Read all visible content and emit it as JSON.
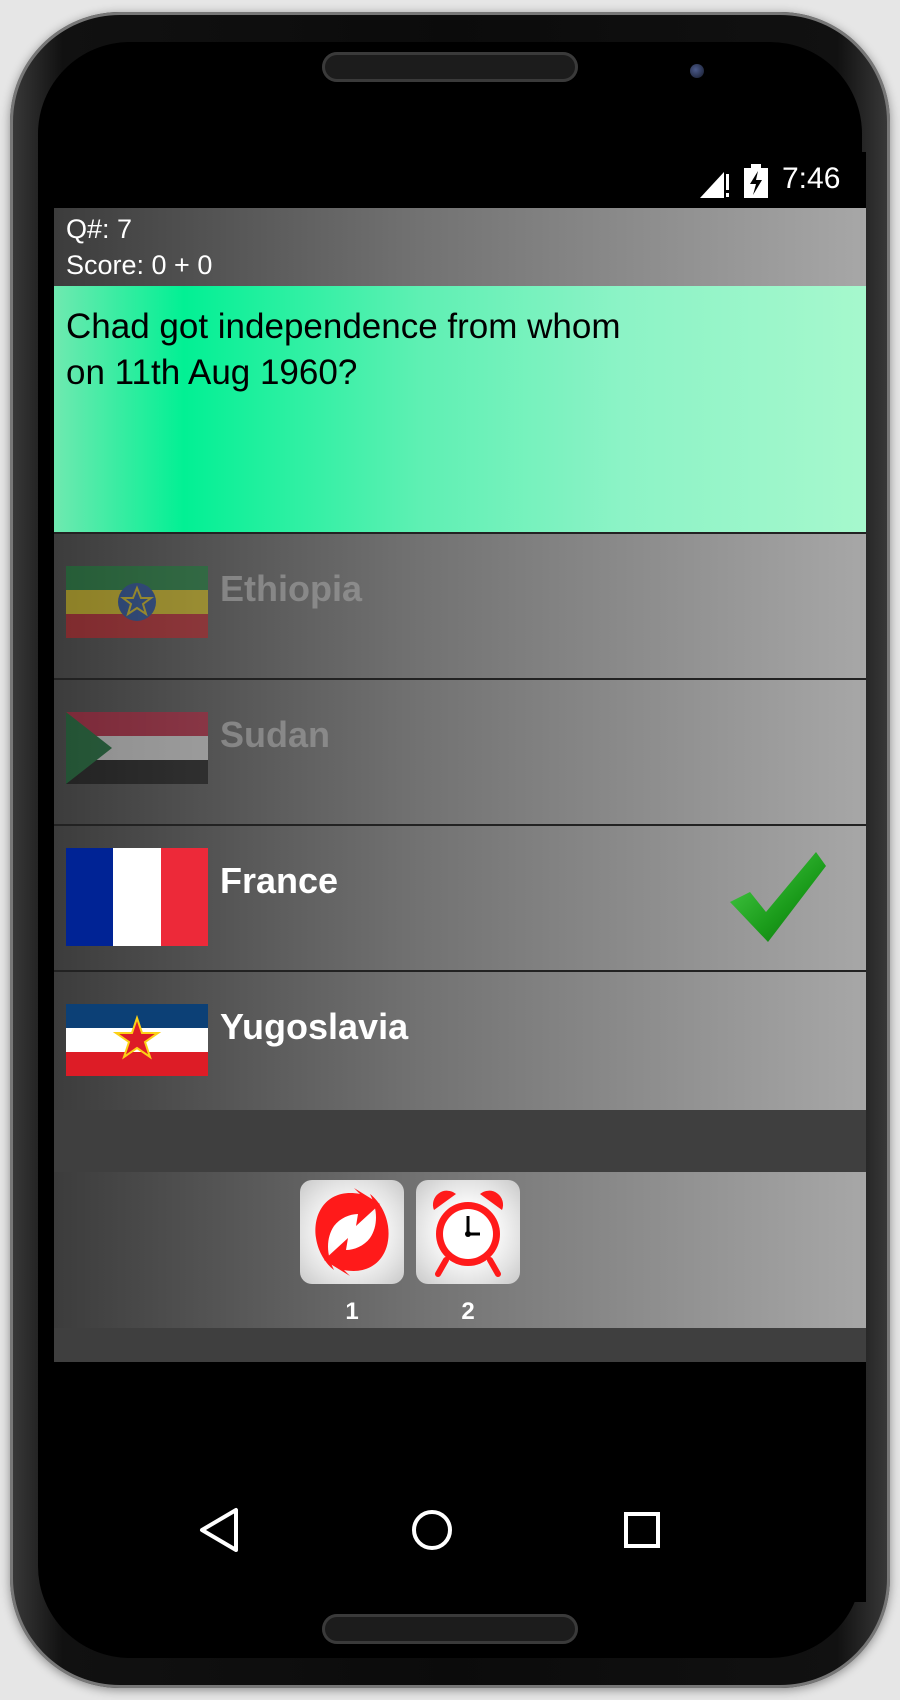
{
  "status_bar": {
    "time": "7:46",
    "icons": [
      "signal-icon",
      "battery-charging-icon"
    ]
  },
  "quiz": {
    "question_number_label": "Q#: 7",
    "score_label": "Score: 0 + 0",
    "question": "Chad got independence from whom on 11th Aug 1960?"
  },
  "answers": [
    {
      "label": "Ethiopia",
      "flag_icon": "ethiopia-flag-icon",
      "state": "eliminated"
    },
    {
      "label": "Sudan",
      "flag_icon": "sudan-flag-icon",
      "state": "eliminated"
    },
    {
      "label": "France",
      "flag_icon": "france-flag-icon",
      "state": "correct"
    },
    {
      "label": "Yugoslavia",
      "flag_icon": "yugoslavia-flag-icon",
      "state": "normal"
    }
  ],
  "lifelines": [
    {
      "icon": "refresh-arrows-icon",
      "count": "1"
    },
    {
      "icon": "alarm-clock-icon",
      "count": "2"
    }
  ],
  "navigation": [
    "back-icon",
    "home-icon",
    "recents-icon"
  ],
  "colors": {
    "question_bg": "#02f094",
    "correct_check": "#1a9b1a",
    "lifeline_icon": "#ff1a1a"
  }
}
